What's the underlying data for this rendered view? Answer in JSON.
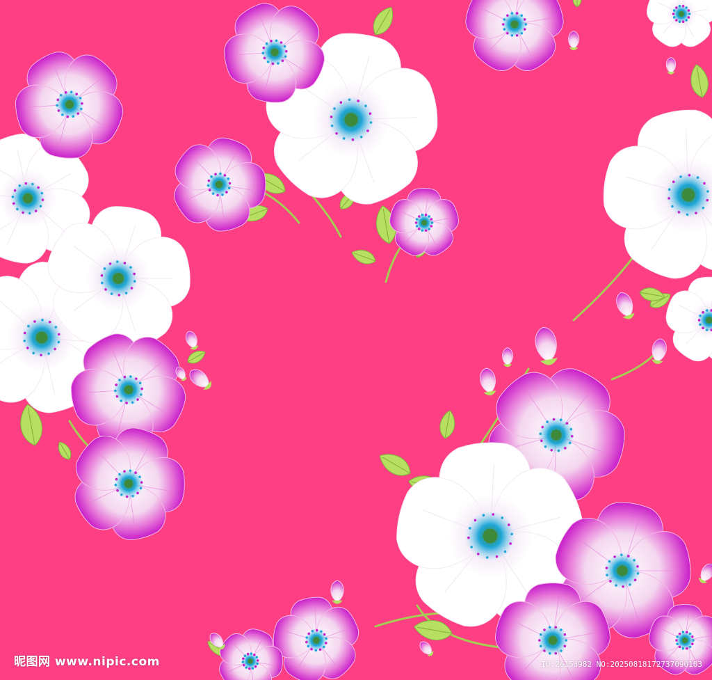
{
  "image": {
    "subject": "floral-pattern",
    "colors": {
      "background": "#ff3f84",
      "petal": "#ffffff",
      "petal_shadow": "#ead3ee",
      "petal_tip": "#c81ec9",
      "petal_tip_light": "#e77ad9",
      "center_blue": "#1ea6d8",
      "center_green": "#3f8a3a",
      "leaf": "#b7df62",
      "leaf_dark": "#7fb03a",
      "stem": "#a3cf52"
    }
  },
  "watermark": {
    "site": "昵图网 www.nipic.com",
    "id_text": "ID:26153982 NO:20250818172737090103"
  }
}
